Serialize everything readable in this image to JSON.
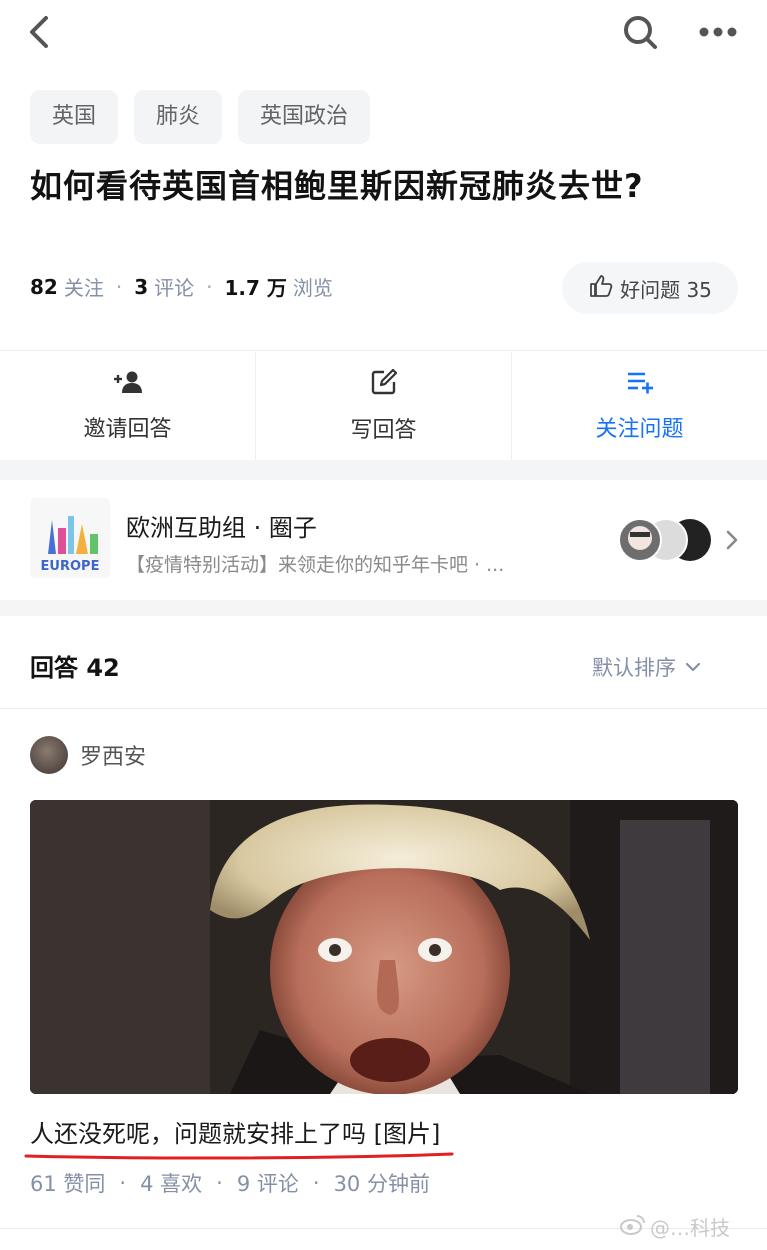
{
  "tags": [
    "英国",
    "肺炎",
    "英国政治"
  ],
  "question": {
    "title": "如何看待英国首相鲍里斯因新冠肺炎去世?",
    "follow_count": "82",
    "follow_label": "关注",
    "comment_count": "3",
    "comment_label": "评论",
    "view_count": "1.7 万",
    "view_label": "浏览",
    "good_label": "好问题 35"
  },
  "actions": {
    "invite": "邀请回答",
    "write": "写回答",
    "follow": "关注问题"
  },
  "circle": {
    "title": "欧洲互助组 · 圈子",
    "subtitle": "【疫情特别活动】来领走你的知乎年卡吧 · ...",
    "logo_text": "EUROPE"
  },
  "answers": {
    "header": "回答 42",
    "sort_label": "默认排序"
  },
  "answer": {
    "author": "罗西安",
    "excerpt": "人还没死呢，问题就安排上了吗 [图片]",
    "likes": "61 赞同",
    "favorites": "4 喜欢",
    "comments": "9 评论",
    "time": "30 分钟前"
  },
  "watermark": "@…科技",
  "colors": {
    "accent": "#1772f6",
    "meta_gray": "#8590a6",
    "underline": "#e02020"
  }
}
